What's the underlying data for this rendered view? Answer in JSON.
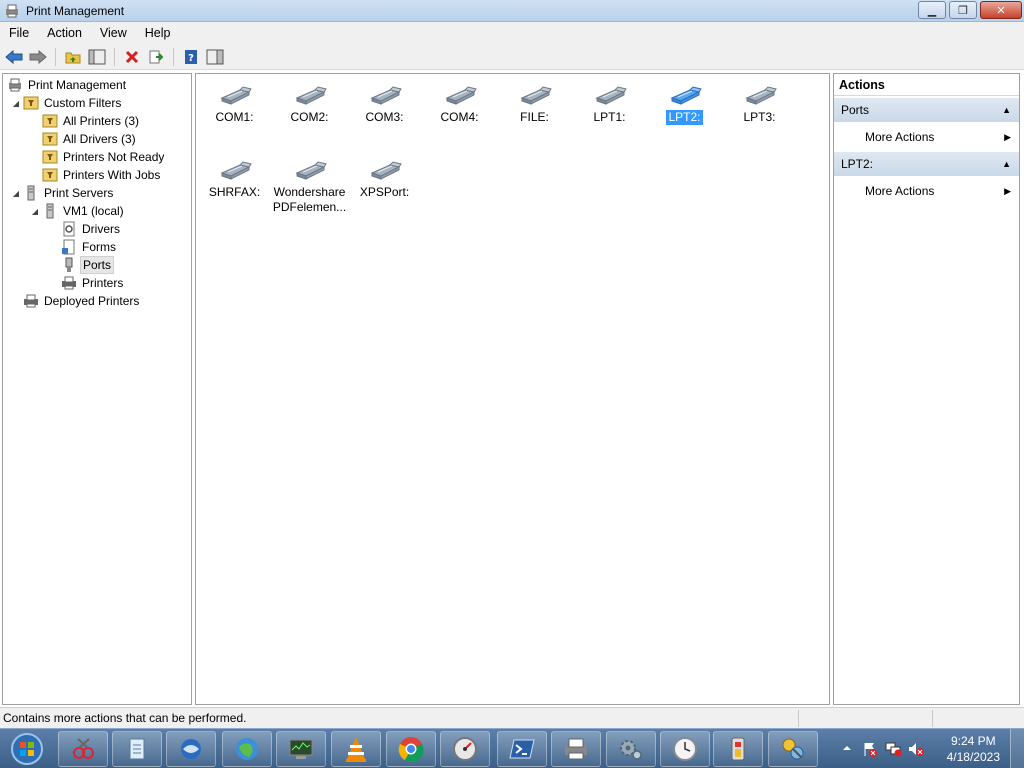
{
  "window": {
    "title": "Print Management",
    "controls": {
      "minimize": "▁",
      "restore": "❐",
      "close": "✕"
    }
  },
  "menu": {
    "items": [
      "File",
      "Action",
      "View",
      "Help"
    ]
  },
  "toolbar": {
    "buttons": [
      "back-icon",
      "forward-icon",
      "up-folder-icon",
      "show-hide-tree-icon",
      "delete-icon",
      "export-list-icon",
      "help-icon",
      "show-hide-action-pane-icon"
    ]
  },
  "tree": {
    "root": "Print Management",
    "custom_filters": "Custom Filters",
    "all_printers": "All Printers (3)",
    "all_drivers": "All Drivers (3)",
    "printers_not_ready": "Printers Not Ready",
    "printers_with_jobs": "Printers With Jobs",
    "print_servers": "Print Servers",
    "server": "VM1 (local)",
    "drivers": "Drivers",
    "forms": "Forms",
    "ports": "Ports",
    "printers": "Printers",
    "deployed_printers": "Deployed Printers"
  },
  "ports": [
    {
      "label": "COM1:",
      "selected": false
    },
    {
      "label": "COM2:",
      "selected": false
    },
    {
      "label": "COM3:",
      "selected": false
    },
    {
      "label": "COM4:",
      "selected": false
    },
    {
      "label": "FILE:",
      "selected": false
    },
    {
      "label": "LPT1:",
      "selected": false
    },
    {
      "label": "LPT2:",
      "selected": true
    },
    {
      "label": "LPT3:",
      "selected": false
    },
    {
      "label": "SHRFAX:",
      "selected": false
    },
    {
      "label": "Wondershare PDFelemen...",
      "selected": false
    },
    {
      "label": "XPSPort:",
      "selected": false
    }
  ],
  "actions": {
    "header": "Actions",
    "sections": [
      {
        "title": "Ports",
        "item": "More Actions"
      },
      {
        "title": "LPT2:",
        "item": "More Actions"
      }
    ]
  },
  "status": {
    "text": "Contains more actions that can be performed."
  },
  "taskbar": {
    "apps": [
      "snipping-tool-icon",
      "notepad-icon",
      "thunderbird-icon",
      "network-globe-icon",
      "task-manager-icon",
      "vlc-icon",
      "chrome-icon",
      "performance-gauge-icon",
      "powershell-icon",
      "printer-manager-icon",
      "settings-gears-icon",
      "clock-icon",
      "battery-icon",
      "remote-tool-icon"
    ],
    "time": "9:24 PM",
    "date": "4/18/2023"
  },
  "colors": {
    "selection": "#3399ff",
    "port_icon": "#8a9aab",
    "port_icon_selected": "#3a8ee6",
    "action_section": "#cfdceb",
    "taskbar": "#4a6e98"
  }
}
